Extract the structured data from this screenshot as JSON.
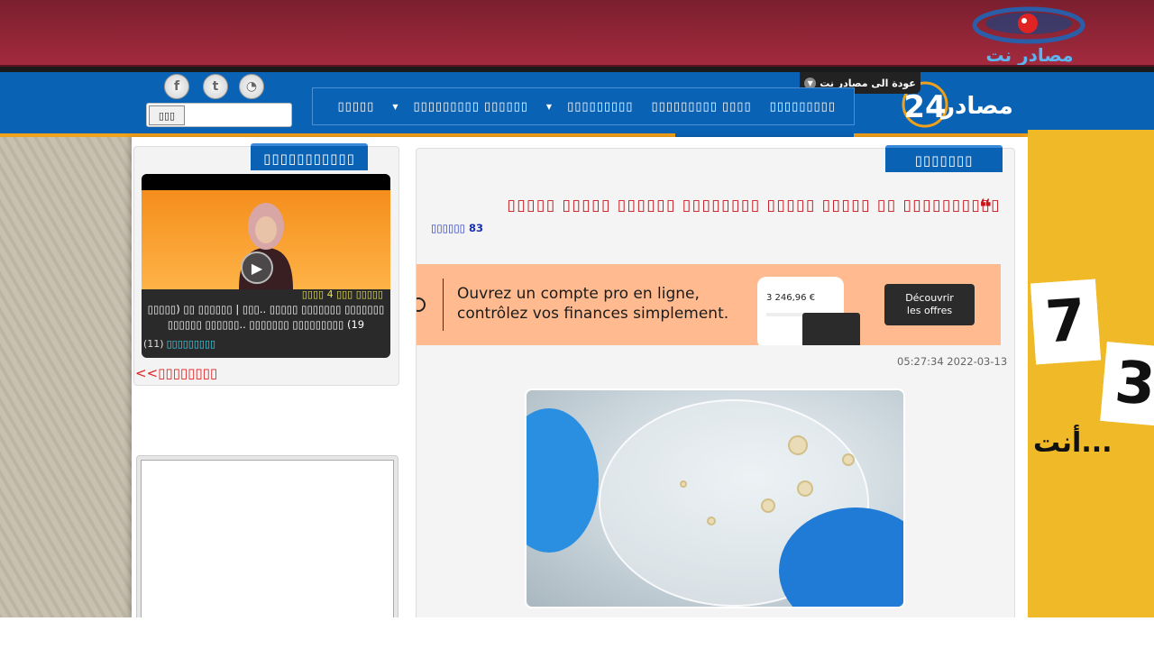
{
  "header": {
    "back_link": "عودة الى مصادر نت",
    "site_logo_text": "مصادر نت",
    "main_logo_text": "مصادر",
    "main_logo_number": "24"
  },
  "nav": {
    "items": [
      {
        "label": "▯▯▯▯▯▯▯▯▯",
        "has_caret": false
      },
      {
        "label": "▯▯▯▯▯▯▯▯▯ ▯▯▯▯",
        "has_caret": false
      },
      {
        "label": "▯▯▯▯▯▯▯▯▯",
        "has_caret": true
      },
      {
        "label": "▯▯▯▯▯▯▯▯▯ ▯▯▯▯▯▯",
        "has_caret": true
      },
      {
        "label": "▯▯▯▯▯",
        "has_caret": false
      }
    ],
    "sub_items": [
      "▯▯▯▯▯▯ ▯▯▯▯",
      "▯▯▯ ▯▯▯▯▯"
    ]
  },
  "search": {
    "button_label": "▯▯▯",
    "placeholder": ""
  },
  "social": {
    "rss": "rss-icon",
    "twitter": "twitter-icon",
    "facebook": "facebook-icon"
  },
  "sidebar": {
    "tab_title": "▯▯▯▯▯▯▯▯▯▯▯",
    "video": {
      "duration": "▯▯▯▯ 4 ▯▯▯ ▯▯▯▯▯",
      "description": "▯▯▯▯▯▯▯ ▯▯▯▯▯▯▯ ▯▯▯▯▯ ..▯▯▯ | ▯▯▯▯▯▯ ▯▯ (▯▯▯▯▯ 19) ▯▯▯▯▯▯▯▯▯ ▯▯▯▯▯▯▯ ..▯▯▯▯▯▯ ▯▯▯▯▯▯",
      "count": "(11)",
      "category": "▯▯▯▯▯▯▯▯▯"
    },
    "more_link": "<<▯▯▯▯▯▯▯▯"
  },
  "article": {
    "tab_title": "▯▯▯▯▯▯▯",
    "title": "▯▯▯▯▯▯▯▯▯▯ ▯▯ ▯▯▯▯▯ ▯▯▯▯▯ ▯▯▯▯▯▯▯▯ ▯▯▯▯▯▯ ▯▯▯▯▯ ▯▯▯▯▯",
    "views": "▯▯▯▯▯▯ 83",
    "timestamp": "05:27:34 2022-03-13"
  },
  "banner_ad": {
    "line1": "Ouvrez un compte pro en ligne,",
    "line2": "contrôlez vos finances simplement.",
    "amount": "3 246,96 €",
    "cta_line1": "Découvrir",
    "cta_line2": "les offres"
  },
  "right_ad": {
    "tile1": "7",
    "tile2": "3",
    "caption": "أنت..."
  },
  "colors": {
    "maroon": "#a32a3e",
    "blue": "#0a62b5",
    "orange": "#f0a11a",
    "title_red": "#c4161c"
  }
}
